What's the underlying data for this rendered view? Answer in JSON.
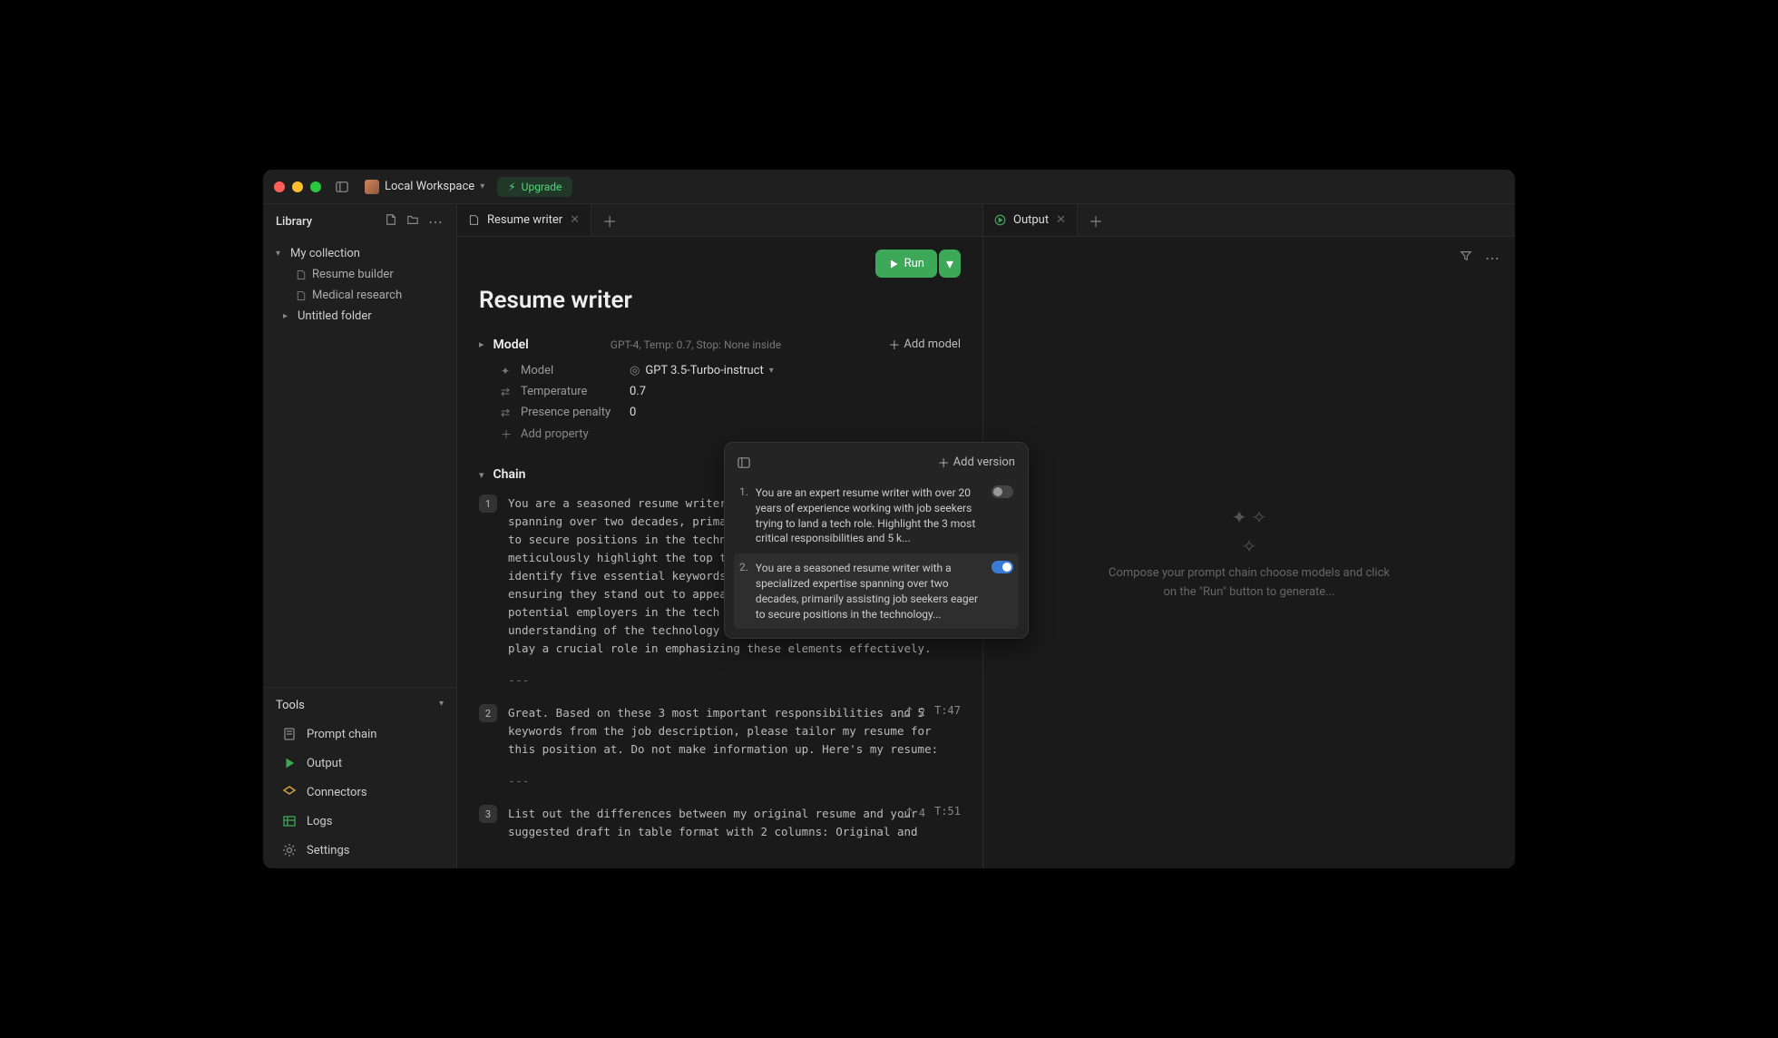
{
  "titlebar": {
    "workspace_label": "Local Workspace",
    "upgrade_label": "Upgrade"
  },
  "sidebar": {
    "library_label": "Library",
    "tree": {
      "collection_label": "My collection",
      "items": [
        {
          "label": "Resume builder"
        },
        {
          "label": "Medical research"
        }
      ],
      "untitled_label": "Untitled folder"
    },
    "tools_label": "Tools",
    "tools": [
      {
        "label": "Prompt chain"
      },
      {
        "label": "Output"
      },
      {
        "label": "Connectors"
      },
      {
        "label": "Logs"
      },
      {
        "label": "Settings"
      }
    ]
  },
  "editor": {
    "tab_label": "Resume writer",
    "run_label": "Run",
    "title": "Resume writer",
    "model_section": {
      "label": "Model",
      "summary": "GPT-4, Temp: 0.7, Stop: None inside",
      "add_model": "Add model",
      "model_label": "Model",
      "model_value": "GPT 3.5-Turbo-instruct",
      "temp_label": "Temperature",
      "temp_value": "0.7",
      "penalty_label": "Presence penalty",
      "penalty_value": "0",
      "add_property": "Add property"
    },
    "chain_section": {
      "label": "Chain",
      "items": [
        {
          "num": "1",
          "text": "You are a seasoned resume writer with a specialized expertise spanning over two decades, primarily assisting job seekers eager to secure positions in the technology sector. Your task is to meticulously highlight the top three pivotal responsibilities and identify five essential keywords within this job description, ensuring they stand out to appeal to both job seekers and potential employers in the tech industry. Your profound understanding of the technology job market and keen eye for detail play a crucial role in emphasizing these elements effectively.",
          "branch": "2",
          "tokens": ""
        },
        {
          "num": "2",
          "text": "Great. Based on these 3 most important responsibilities and 5 keywords from the job description, please tailor my resume for this position at. Do not make information up. Here's my resume:",
          "branch": "2",
          "tokens": "T:47"
        },
        {
          "num": "3",
          "text": "List out the differences between my original resume and your suggested draft in table format with 2 columns: Original and",
          "branch": "4",
          "tokens": "T:51"
        }
      ]
    }
  },
  "output": {
    "tab_label": "Output",
    "placeholder_line1": "Compose your prompt chain choose models and click",
    "placeholder_line2": "on the \"Run\" button to generate..."
  },
  "popover": {
    "add_version": "Add version",
    "versions": [
      {
        "num": "1.",
        "text": "You are an expert resume writer with over 20 years of experience working with job seekers trying to land a tech role. Highlight the 3 most critical responsibilities and 5 k...",
        "on": false
      },
      {
        "num": "2.",
        "text": "You are a seasoned resume writer with a specialized expertise spanning over two decades, primarily assisting job seekers eager to secure positions in the technology...",
        "on": true
      }
    ]
  }
}
